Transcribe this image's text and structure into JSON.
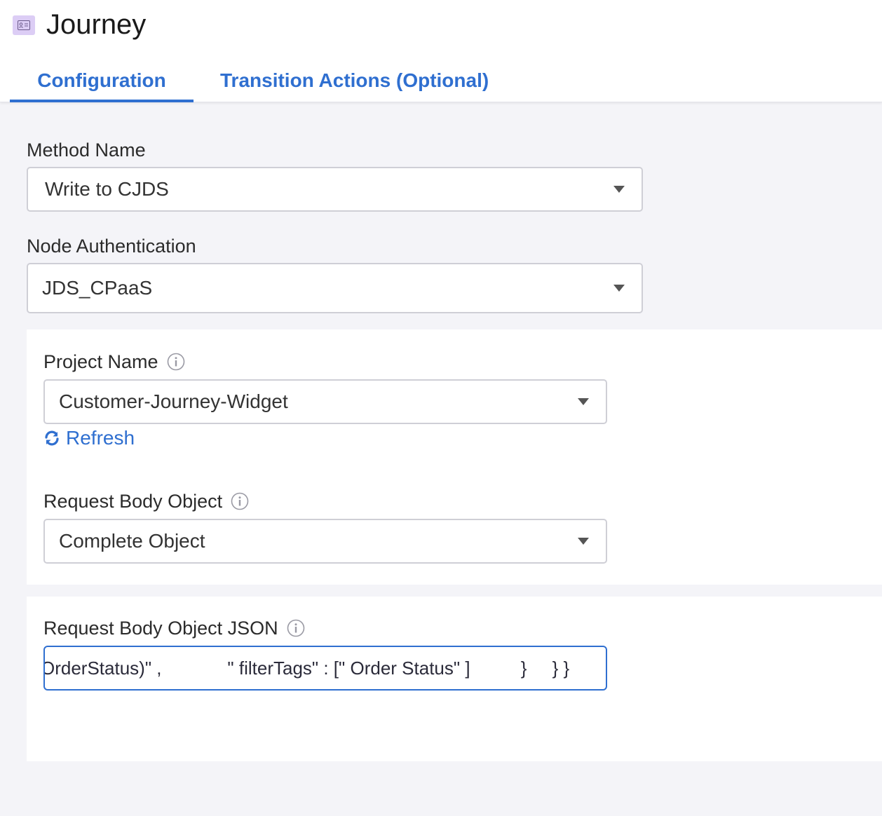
{
  "app": {
    "title": "Journey",
    "icon": "id-card-icon"
  },
  "tabs": [
    {
      "label": "Configuration",
      "active": true
    },
    {
      "label": "Transition Actions (Optional)",
      "active": false
    }
  ],
  "form": {
    "method_name": {
      "label": "Method Name",
      "value": "Write to CJDS"
    },
    "node_authentication": {
      "label": "Node Authentication",
      "value": "JDS_CPaaS"
    },
    "project_name": {
      "label": "Project Name",
      "value": "Customer-Journey-Widget"
    },
    "refresh_label": "Refresh",
    "request_body_object": {
      "label": "Request Body Object",
      "value": "Complete Object"
    },
    "request_body_json": {
      "label": "Request Body Object JSON",
      "value": "OrderStatus)\" ,             \" filterTags\" : [\" Order Status\" ]          }     } }"
    }
  },
  "colors": {
    "accent": "#2f6fd0",
    "icon_bg": "#dccdf5",
    "page_bg": "#f4f4f8"
  }
}
